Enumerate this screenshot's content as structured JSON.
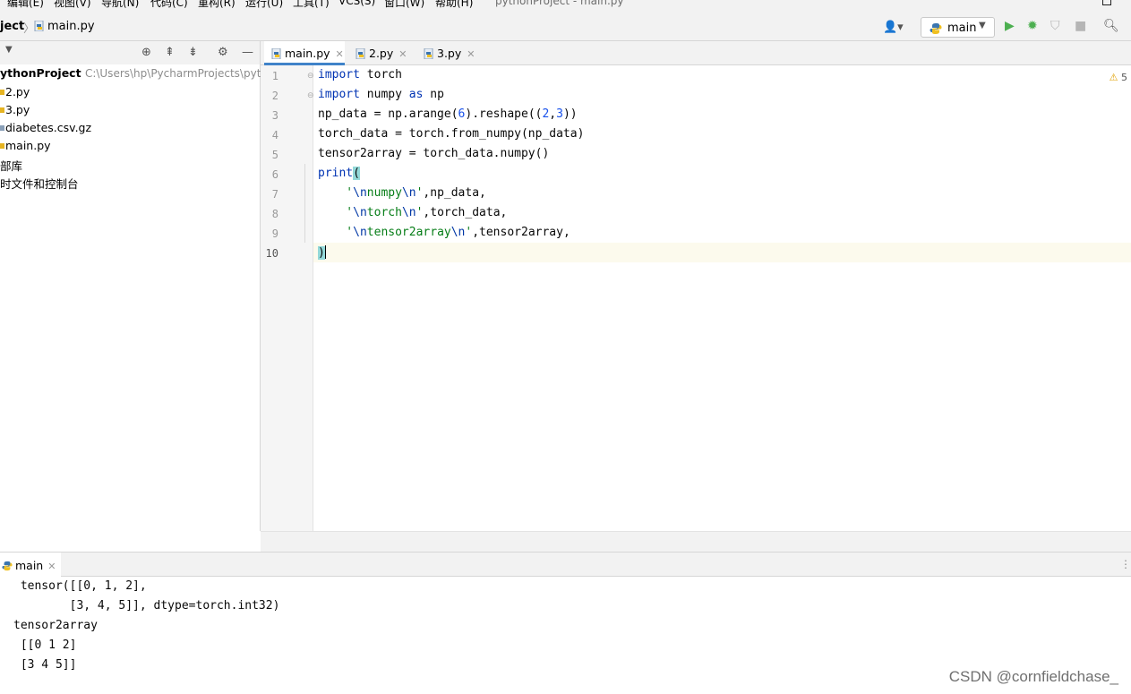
{
  "menu": {
    "items": [
      "编辑(E)",
      "视图(V)",
      "导航(N)",
      "代码(C)",
      "重构(R)",
      "运行(U)",
      "工具(T)",
      "VCS(S)",
      "窗口(W)",
      "帮助(H)"
    ],
    "window_title": "pythonProject - main.py"
  },
  "breadcrumb": {
    "project": "ject",
    "file": "main.py"
  },
  "toolbar": {
    "run_config": "main"
  },
  "project_panel": {
    "root_name": "ythonProject",
    "root_path": "C:\\Users\\hp\\PycharmProjects\\python",
    "items": [
      "2.py",
      "3.py",
      "diabetes.csv.gz",
      "main.py",
      "部库",
      "时文件和控制台"
    ]
  },
  "editor": {
    "tabs": [
      {
        "label": "main.py",
        "active": true
      },
      {
        "label": "2.py",
        "active": false
      },
      {
        "label": "3.py",
        "active": false
      }
    ],
    "line_numbers": [
      "1",
      "2",
      "3",
      "4",
      "5",
      "6",
      "7",
      "8",
      "9",
      "10"
    ],
    "code": {
      "l1_kw": "import",
      "l1_rest": " torch",
      "l2_kw": "import",
      "l2_mid": " numpy ",
      "l2_as": "as",
      "l2_rest": " np",
      "l3_a": "np_data = np.arange(",
      "l3_n1": "6",
      "l3_b": ").reshape((",
      "l3_n2": "2",
      "l3_c": ",",
      "l3_n3": "3",
      "l3_d": "))",
      "l4": "torch_data = torch.from_numpy(np_data)",
      "l5": "tensor2array = torch_data.numpy()",
      "l6_fn": "print",
      "l6_paren": "(",
      "l7_q1": "    '",
      "l7_e1": "\\n",
      "l7_t": "numpy",
      "l7_e2": "\\n",
      "l7_q2": "'",
      "l7_rest": ",np_data,",
      "l8_q1": "    '",
      "l8_e1": "\\n",
      "l8_t": "torch",
      "l8_e2": "\\n",
      "l8_q2": "'",
      "l8_rest": ",torch_data,",
      "l9_q1": "    '",
      "l9_e1": "\\n",
      "l9_t": "tensor2array",
      "l9_e2": "\\n",
      "l9_q2": "'",
      "l9_rest": ",tensor2array,",
      "l10": ")"
    },
    "warning_count": "5"
  },
  "run": {
    "tab_label": "main",
    "output": [
      " tensor([[0, 1, 2],",
      "        [3, 4, 5]], dtype=torch.int32)",
      "tensor2array",
      " [[0 1 2]",
      " [3 4 5]]"
    ]
  },
  "watermark": "CSDN @cornfieldchase_"
}
